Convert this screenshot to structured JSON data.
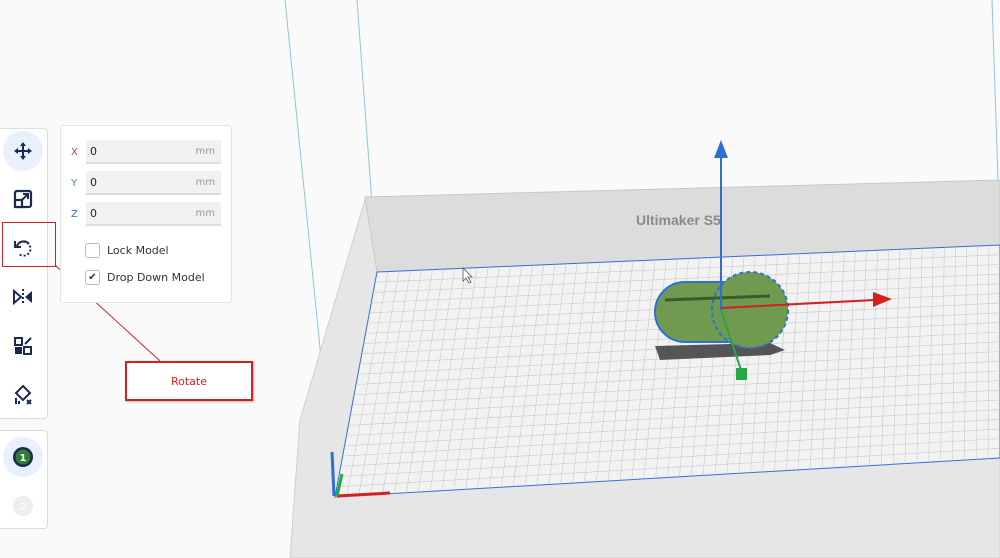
{
  "toolbar": {
    "tools": [
      {
        "name": "move",
        "icon": "move-icon",
        "active": true
      },
      {
        "name": "scale",
        "icon": "scale-icon"
      },
      {
        "name": "rotate",
        "icon": "rotate-icon"
      },
      {
        "name": "mirror",
        "icon": "mirror-icon"
      },
      {
        "name": "per-model-settings",
        "icon": "per-model-settings-icon"
      },
      {
        "name": "support-blocker",
        "icon": "support-blocker-icon"
      }
    ],
    "extruders": [
      {
        "label": "1",
        "active": true,
        "color": "#2e7d32"
      },
      {
        "label": "2",
        "active": false
      }
    ]
  },
  "move_panel": {
    "x": {
      "label": "X",
      "value": "0",
      "unit": "mm",
      "color": "#d43a3a"
    },
    "y": {
      "label": "Y",
      "value": "0",
      "unit": "mm",
      "color": "#3a9a6a"
    },
    "z": {
      "label": "Z",
      "value": "0",
      "unit": "mm",
      "color": "#3a6ad4"
    },
    "lock_model": {
      "label": "Lock Model",
      "checked": false
    },
    "drop_down_model": {
      "label": "Drop Down Model",
      "checked": true,
      "mark": "✔"
    }
  },
  "annotation": {
    "label": "Rotate",
    "color": "#d42020"
  },
  "viewport": {
    "printer_label": "Ultimaker S5",
    "model_color": "#6f9a4f",
    "selection_color": "#2d6fd6"
  }
}
